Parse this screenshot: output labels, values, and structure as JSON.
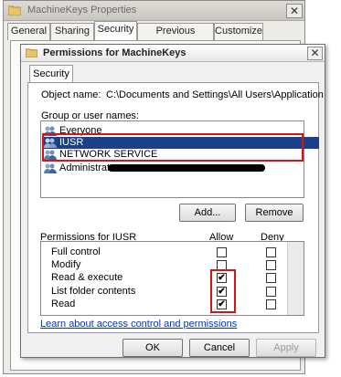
{
  "outer_window": {
    "title": "MachineKeys Properties",
    "close_glyph": "✕",
    "tabs": [
      "General",
      "Sharing",
      "Security",
      "Previous Versions",
      "Customize"
    ],
    "active_tab": "Security",
    "buttons": {
      "ok": "OK",
      "cancel": "Cancel",
      "apply": "Apply"
    }
  },
  "inner_dialog": {
    "title": "Permissions for MachineKeys",
    "close_glyph": "✕",
    "tab": "Security",
    "object_name_label": "Object name:",
    "object_name_value": "C:\\Documents and Settings\\All Users\\Application D",
    "groups_label": "Group or user names:",
    "groups": [
      {
        "name": "Everyone",
        "selected": false
      },
      {
        "name": "IUSR",
        "selected": true
      },
      {
        "name": "NETWORK SERVICE",
        "selected": false
      },
      {
        "name": "Administrators",
        "selected": false
      }
    ],
    "add_button": "Add...",
    "remove_button": "Remove",
    "permissions_label": "Permissions for IUSR",
    "allow_header": "Allow",
    "deny_header": "Deny",
    "permissions": [
      {
        "name": "Full control",
        "allow": false,
        "deny": false
      },
      {
        "name": "Modify",
        "allow": false,
        "deny": false
      },
      {
        "name": "Read & execute",
        "allow": true,
        "deny": false
      },
      {
        "name": "List folder contents",
        "allow": true,
        "deny": false
      },
      {
        "name": "Read",
        "allow": true,
        "deny": false
      }
    ],
    "check_glyph": "✔",
    "help_link": "Learn about access control and permissions",
    "ok_button": "OK",
    "cancel_button": "Cancel",
    "apply_button": "Apply"
  },
  "colors": {
    "selection": "#1c3f8a",
    "highlight_box": "#d3151b",
    "link": "#0033cc"
  },
  "icons": [
    "folder-icon",
    "close-icon",
    "user-group-icon"
  ]
}
